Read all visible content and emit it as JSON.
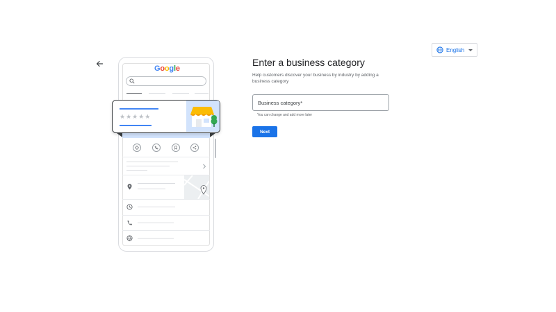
{
  "language": {
    "label": "English",
    "icon": "globe-icon"
  },
  "back": {
    "icon": "arrow-back-icon"
  },
  "illustration": {
    "logo": {
      "g1": "G",
      "o1": "o",
      "o2": "o",
      "g2": "g",
      "l": "l",
      "e": "e"
    },
    "stars": "★★★★★",
    "rating_stars": 5
  },
  "form": {
    "title": "Enter a business category",
    "description": "Help customers discover your business by industry by adding a business category",
    "field_placeholder": "Business category*",
    "field_value": "",
    "helper": "You can change and add more later",
    "next_label": "Next"
  },
  "colors": {
    "accent": "#1a73e8",
    "google_blue": "#4285f4",
    "google_red": "#ea4335",
    "google_yellow": "#fbbc05",
    "google_green": "#34a853"
  }
}
